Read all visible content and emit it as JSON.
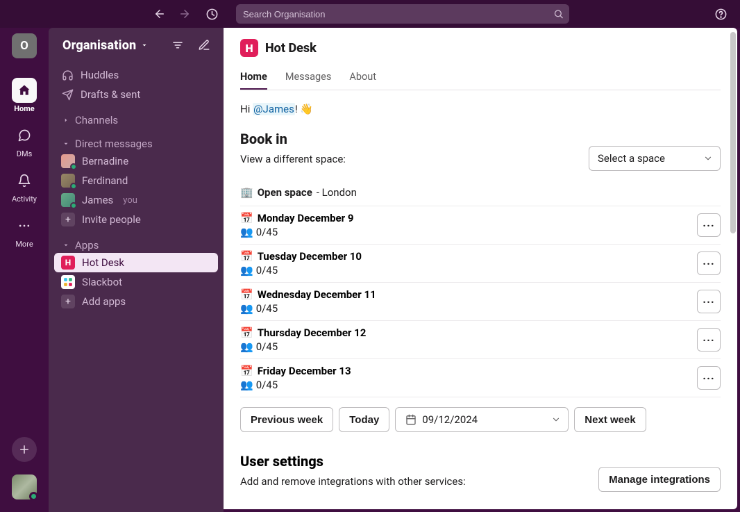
{
  "topbar": {
    "search_placeholder": "Search Organisation"
  },
  "rail": {
    "workspace_initial": "O",
    "items": [
      {
        "label": "Home"
      },
      {
        "label": "DMs"
      },
      {
        "label": "Activity"
      },
      {
        "label": "More"
      }
    ]
  },
  "sidebar": {
    "org_name": "Organisation",
    "rows": {
      "huddles": "Huddles",
      "drafts": "Drafts & sent"
    },
    "sections": {
      "channels": "Channels",
      "dms": "Direct messages",
      "apps": "Apps"
    },
    "dms": [
      {
        "name": "Bernadine"
      },
      {
        "name": "Ferdinand"
      },
      {
        "name": "James",
        "you": "you"
      }
    ],
    "invite": "Invite people",
    "apps": [
      {
        "name": "Hot Desk"
      },
      {
        "name": "Slackbot"
      }
    ],
    "add_apps": "Add apps"
  },
  "main": {
    "app_title": "Hot Desk",
    "tabs": {
      "home": "Home",
      "messages": "Messages",
      "about": "About"
    },
    "greeting_prefix": "Hi ",
    "greeting_mention": "@James",
    "greeting_suffix": "! 👋",
    "book_in": "Book in",
    "view_space_label": "View a different space:",
    "space_select": "Select a space",
    "space_emoji": "🏢",
    "space_name": "Open space",
    "space_city_suffix": " - London",
    "days": [
      {
        "label": "Monday December 9",
        "count": "0/45"
      },
      {
        "label": "Tuesday December 10",
        "count": "0/45"
      },
      {
        "label": "Wednesday December 11",
        "count": "0/45"
      },
      {
        "label": "Thursday December 12",
        "count": "0/45"
      },
      {
        "label": "Friday December 13",
        "count": "0/45"
      }
    ],
    "prev_week": "Previous week",
    "today": "Today",
    "date_value": "09/12/2024",
    "next_week": "Next week",
    "settings_head": "User settings",
    "settings_sub": "Add and remove integrations with other services:",
    "manage": "Manage integrations"
  }
}
